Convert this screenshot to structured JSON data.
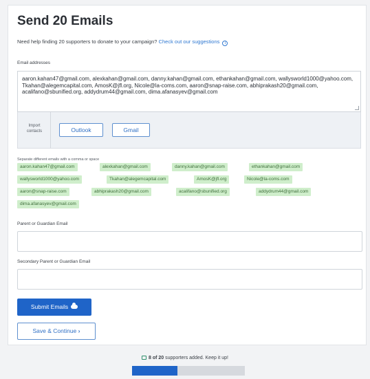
{
  "page": {
    "title": "Send 20 Emails",
    "help_text": "Need help finding 20 supporters to donate to your campaign?",
    "help_link": "Check out our suggestions",
    "help_icon": "info-icon"
  },
  "emails": {
    "label": "Email addresses",
    "textarea_value": "aaron.kahan47@gmail.com, alexkahan@gmail.com, danny.kahan@gmail.com, ethankahan@gmail.com, wallysworld1000@yahoo.com, Tkahan@alegemcapital.com, AmosK@jfl.org, Nicole@la-coms.com, aaron@snap-raise.com, abhiprakash20@gmail.com, acalifano@sbunified.org, addydrum44@gmail.com, dima.afanasyev@gmail.com",
    "import_label": "Import contacts",
    "outlook_label": "Outlook",
    "gmail_label": "Gmail",
    "separator_note": "Separate different emails with a comma or space",
    "chips": [
      "aaron.kahan47@gmail.com",
      "alexkahan@gmail.com",
      "danny.kahan@gmail.com",
      "ethankahan@gmail.com",
      "wallysworld1000@yahoo.com",
      "Tkahan@alegemcapital.com",
      "AmosK@jfl.org",
      "Nicole@la-coms.com",
      "aaron@snap-raise.com",
      "abhiprakash20@gmail.com",
      "acalifano@sbunified.org",
      "addydrum44@gmail.com",
      "dima.afanasyev@gmail.com"
    ]
  },
  "parent": {
    "label": "Parent or Guardian Email",
    "value": ""
  },
  "secondary_parent": {
    "label": "Secondary Parent or Guardian Email",
    "value": ""
  },
  "actions": {
    "submit_label": "Submit Emails",
    "submit_icon": "cloud-upload-icon",
    "save_label": "Save & Continue",
    "save_icon": "chevron-right-icon"
  },
  "progress": {
    "count_text": "8 of 20",
    "suffix_text": "supporters added. Keep it up!",
    "added": 8,
    "total": 20,
    "icon": "mail-icon"
  },
  "colors": {
    "primary": "#1f64c8",
    "chip_bg": "#cfeecb",
    "chip_text": "#3f6e3b"
  }
}
